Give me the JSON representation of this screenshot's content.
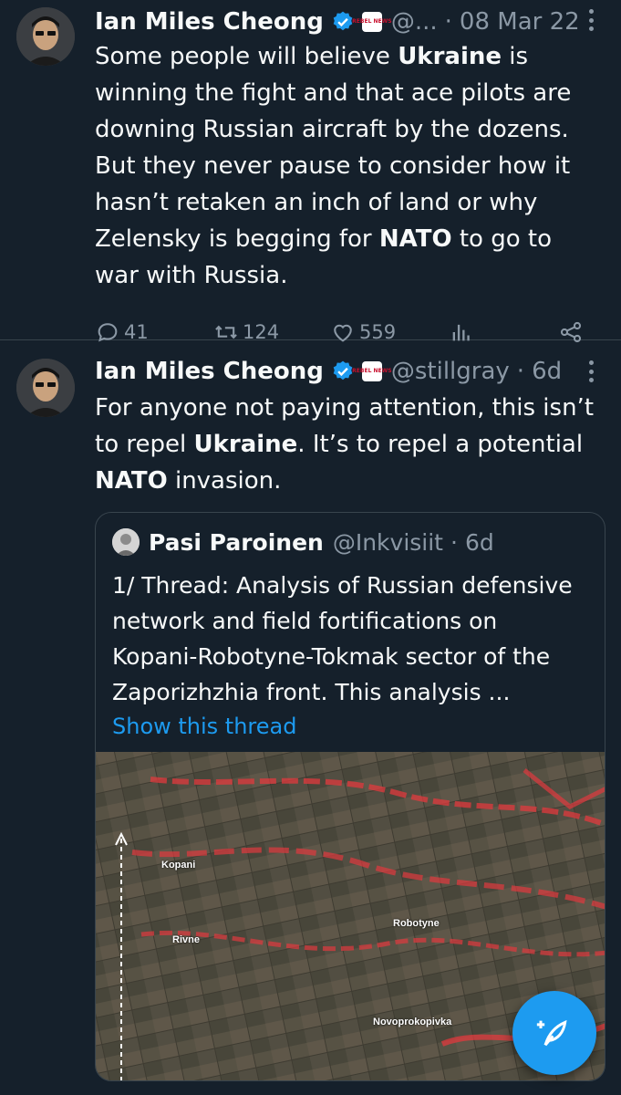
{
  "tweets": [
    {
      "name": "Ian Miles Cheong",
      "handle": "@...",
      "date": "08 Mar 22",
      "text_parts": [
        "Some people will believe ",
        "Ukraine",
        " is winning the fight and that ace pilots are downing Russian aircraft by the dozens. But they never pause to consider how it hasn’t retaken an inch of land or why Zelensky is begging for ",
        "NATO",
        " to go to war with Russia."
      ],
      "replies": "41",
      "retweets": "124",
      "likes": "559"
    },
    {
      "name": "Ian Miles Cheong",
      "handle": "@stillgray",
      "date": "6d",
      "text_parts": [
        "For anyone not paying attention, this isn’t to repel ",
        "Ukraine",
        ". It’s to repel a potential ",
        "NATO",
        " invasion."
      ]
    }
  ],
  "affiliate_badge": "REBEL NEWS",
  "dot_separator": "·",
  "quote": {
    "name": "Pasi Paroinen",
    "handle": "@Inkvisiit",
    "date": "6d",
    "text": "1/ Thread: Analysis of Russian defensive network and field fortifications on Kopani-Robotyne-Tokmak sector of the Zaporizhzhia front. This analysis ...",
    "show_thread": "Show this thread",
    "map_labels": [
      "Kopani",
      "Rivne",
      "Robotyne",
      "Novoprokopivka"
    ]
  },
  "icons": {
    "verified": "verified-badge-icon",
    "more": "more-vertical-icon",
    "reply": "reply-icon",
    "retweet": "retweet-icon",
    "like": "heart-icon",
    "views": "views-icon",
    "share": "share-icon",
    "compose": "compose-feather-icon"
  },
  "colors": {
    "background": "#15202b",
    "text": "#f7f9f9",
    "muted": "#8b98a5",
    "accent": "#1d9bf0",
    "border": "#38444d"
  }
}
